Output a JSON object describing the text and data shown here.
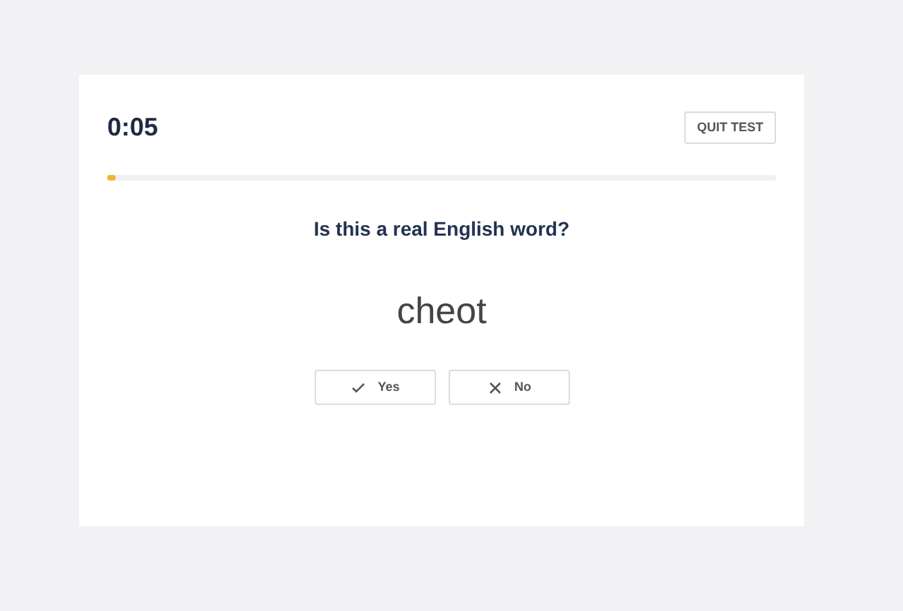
{
  "timer": "0:05",
  "quit_button": "QUIT TEST",
  "progress": {
    "level": 0.012
  },
  "question": "Is this a real English word?",
  "word": "cheot",
  "answers": [
    {
      "kind": "check",
      "label": "Yes"
    },
    {
      "kind": "cross",
      "label": "No"
    }
  ]
}
